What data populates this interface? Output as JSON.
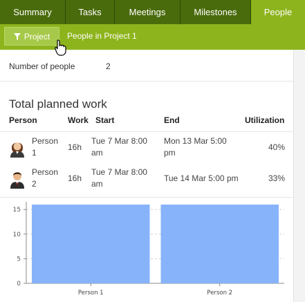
{
  "tabs": [
    {
      "label": "Summary",
      "active": false
    },
    {
      "label": "Tasks",
      "active": false
    },
    {
      "label": "Meetings",
      "active": false
    },
    {
      "label": "Milestones",
      "active": false
    },
    {
      "label": "People",
      "active": true
    }
  ],
  "toolbar": {
    "filter_label": "Project",
    "title": "People in Project 1"
  },
  "summary": {
    "people_label": "Number of people",
    "people_value": "2"
  },
  "planned_work": {
    "title": "Total planned work",
    "headers": {
      "person": "Person",
      "work": "Work",
      "start": "Start",
      "end": "End",
      "utilization": "Utilization"
    },
    "rows": [
      {
        "person_line1": "Person",
        "person_line2": "1",
        "work": "16h",
        "start_line1": "Tue 7 Mar 8:00",
        "start_line2": "am",
        "end_line1": "Mon 13 Mar 5:00",
        "end_line2": "pm",
        "utilization": "40%",
        "avatar": "female-avatar-icon"
      },
      {
        "person_line1": "Person",
        "person_line2": "2",
        "work": "16h",
        "start_line1": "Tue 7 Mar 8:00",
        "start_line2": "am",
        "end_line1": "Tue 14 Mar 5:00 pm",
        "end_line2": "",
        "utilization": "33%",
        "avatar": "male-avatar-icon"
      }
    ]
  },
  "colors": {
    "tab_bar": "#3f5a0b",
    "tab": "#4a6b0c",
    "active_tab": "#8db41c",
    "bar": "#87b3fb"
  },
  "chart_data": {
    "type": "bar",
    "categories": [
      "Person 1",
      "Person 2"
    ],
    "values": [
      16,
      16
    ],
    "yticks": [
      0,
      5,
      10,
      15
    ],
    "ylim": [
      0,
      16
    ],
    "grid": true,
    "title": "",
    "xlabel": "",
    "ylabel": ""
  }
}
